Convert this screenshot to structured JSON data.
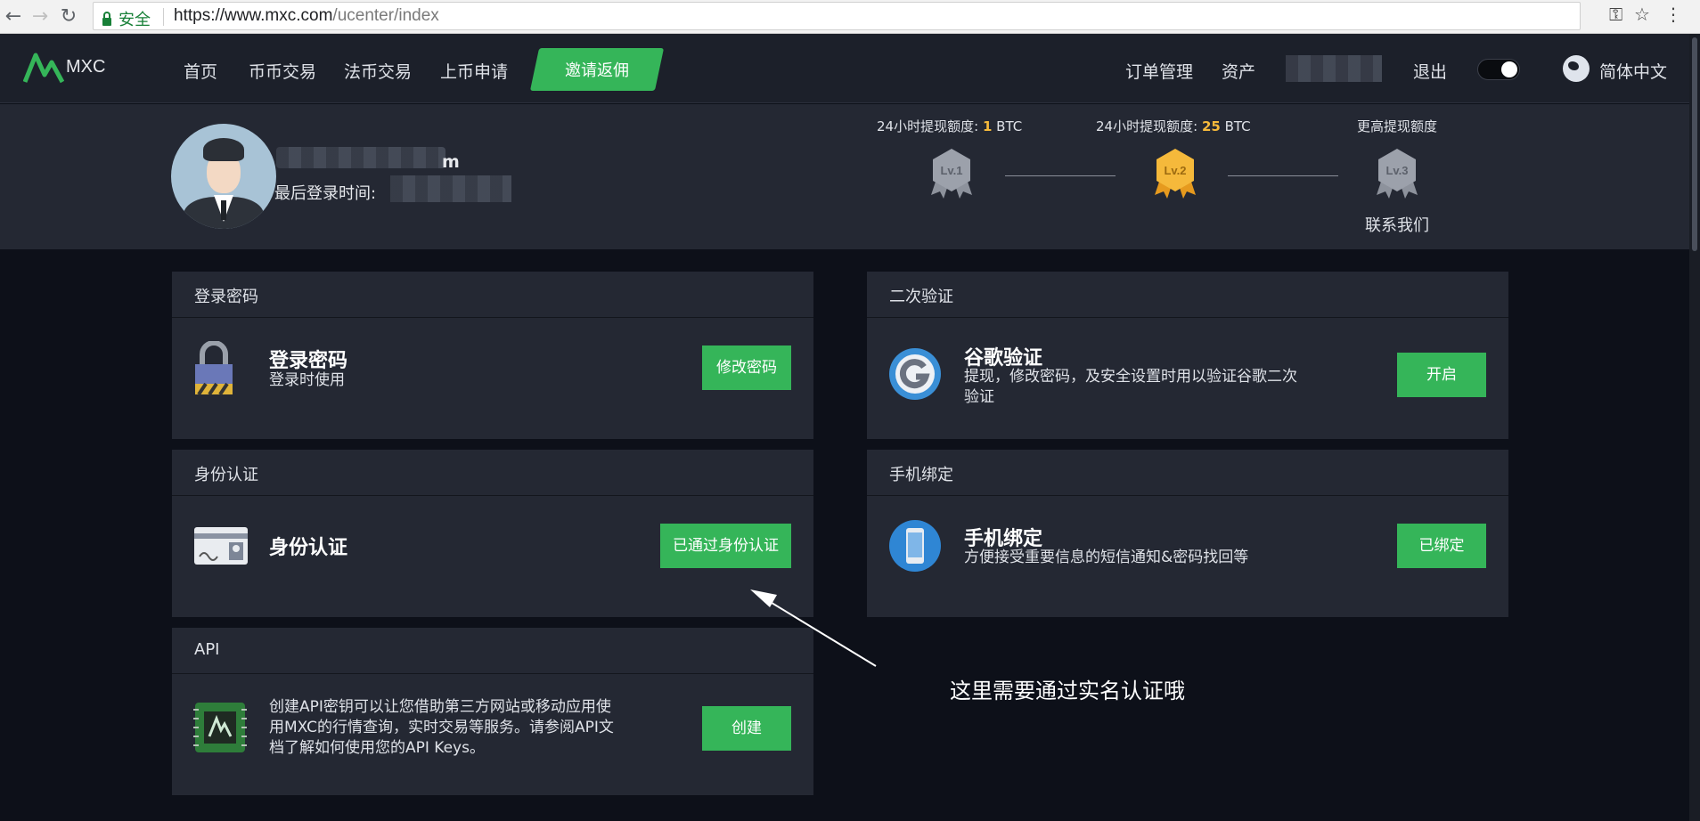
{
  "browser": {
    "secure_label": "安全",
    "url_host": "https://www.mxc.com",
    "url_path": "/ucenter/index"
  },
  "header": {
    "logo_text": "MXC",
    "nav": [
      "首页",
      "币币交易",
      "法币交易",
      "上币申请"
    ],
    "invite_label": "邀请返佣",
    "right": {
      "orders": "订单管理",
      "assets": "资产",
      "logout": "退出",
      "language": "简体中文"
    }
  },
  "profile": {
    "username_suffix": "m",
    "last_login_label": "最后登录时间:",
    "levels": [
      {
        "limit_prefix": "24小时提现额度:",
        "limit_value": "1",
        "limit_unit": "BTC",
        "badge": "Lv.1"
      },
      {
        "limit_prefix": "24小时提现额度:",
        "limit_value": "25",
        "limit_unit": "BTC",
        "badge": "Lv.2"
      },
      {
        "limit_prefix": "更高提现额度",
        "limit_value": "",
        "limit_unit": "",
        "badge": "Lv.3"
      }
    ],
    "contact_label": "联系我们"
  },
  "cards": {
    "password": {
      "header": "登录密码",
      "title": "登录密码",
      "desc": "登录时使用",
      "button": "修改密码"
    },
    "google": {
      "header": "二次验证",
      "title": "谷歌验证",
      "desc_line1": "提现，修改密码，及安全设置时用以验证谷歌二次",
      "desc_line2": "验证",
      "button": "开启"
    },
    "identity": {
      "header": "身份认证",
      "title": "身份认证",
      "button": "已通过身份认证"
    },
    "phone": {
      "header": "手机绑定",
      "title": "手机绑定",
      "desc": "方便接受重要信息的短信通知&密码找回等",
      "button": "已绑定"
    },
    "api": {
      "header": "API",
      "desc_line1": "创建API密钥可以让您借助第三方网站或移动应用使",
      "desc_line2": "用MXC的行情查询，实时交易等服务。请参阅API文",
      "desc_line3": "档了解如何使用您的API Keys。",
      "button": "创建"
    }
  },
  "annotation": "这里需要通过实名认证哦",
  "colors": {
    "accent_green": "#35b559",
    "gold": "#f5b93b",
    "page_bg": "#0d1019",
    "panel_bg": "#242833"
  }
}
